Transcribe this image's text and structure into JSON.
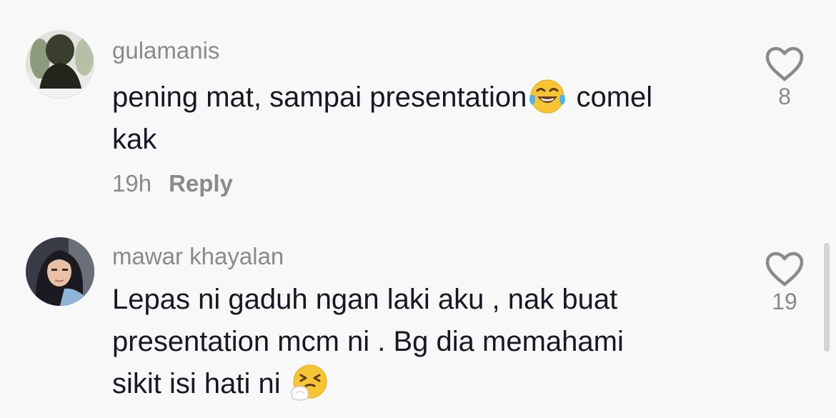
{
  "comments": [
    {
      "username": "gulamanis",
      "text_before_emoji": "pening mat, sampai presentation",
      "emoji": "face-with-tears-of-joy-emoji",
      "text_after_emoji": " comel\nkak",
      "time": "19h",
      "reply_label": "Reply",
      "likes": "8"
    },
    {
      "username": "mawar khayalan",
      "text_before_emoji": "Lepas ni gaduh ngan laki aku , nak buat\npresentation mcm ni . Bg dia memahami\nsikit isi hati ni ",
      "emoji": "sneezing-face-emoji",
      "likes": "19"
    }
  ],
  "colors": {
    "background": "#f8f8f8",
    "text": "#161823",
    "muted": "#8a8a8a"
  }
}
